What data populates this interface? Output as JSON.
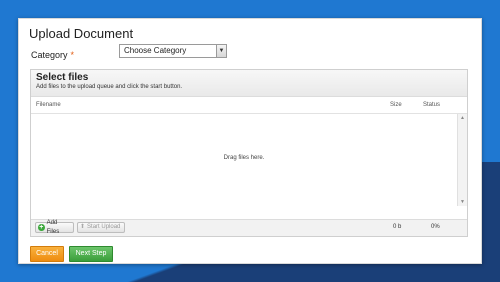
{
  "page": {
    "title": "Upload Document",
    "category": {
      "label": "Category",
      "required_marker": "*",
      "selected": "Choose Category"
    }
  },
  "uploader": {
    "title": "Select files",
    "subtitle": "Add files to the upload queue and click the start button.",
    "columns": {
      "filename": "Filename",
      "size": "Size",
      "status": "Status"
    },
    "drop_text": "Drag files here.",
    "add_files_label": "Add Files",
    "start_upload_label": "Start Upload",
    "total_size": "0 b",
    "total_status": "0%"
  },
  "actions": {
    "cancel_label": "Cancel",
    "next_label": "Next Step"
  },
  "colors": {
    "cancel": "#ee8c10",
    "next": "#3b9e3b",
    "required": "#e25c12",
    "background": "#1f78d1"
  }
}
